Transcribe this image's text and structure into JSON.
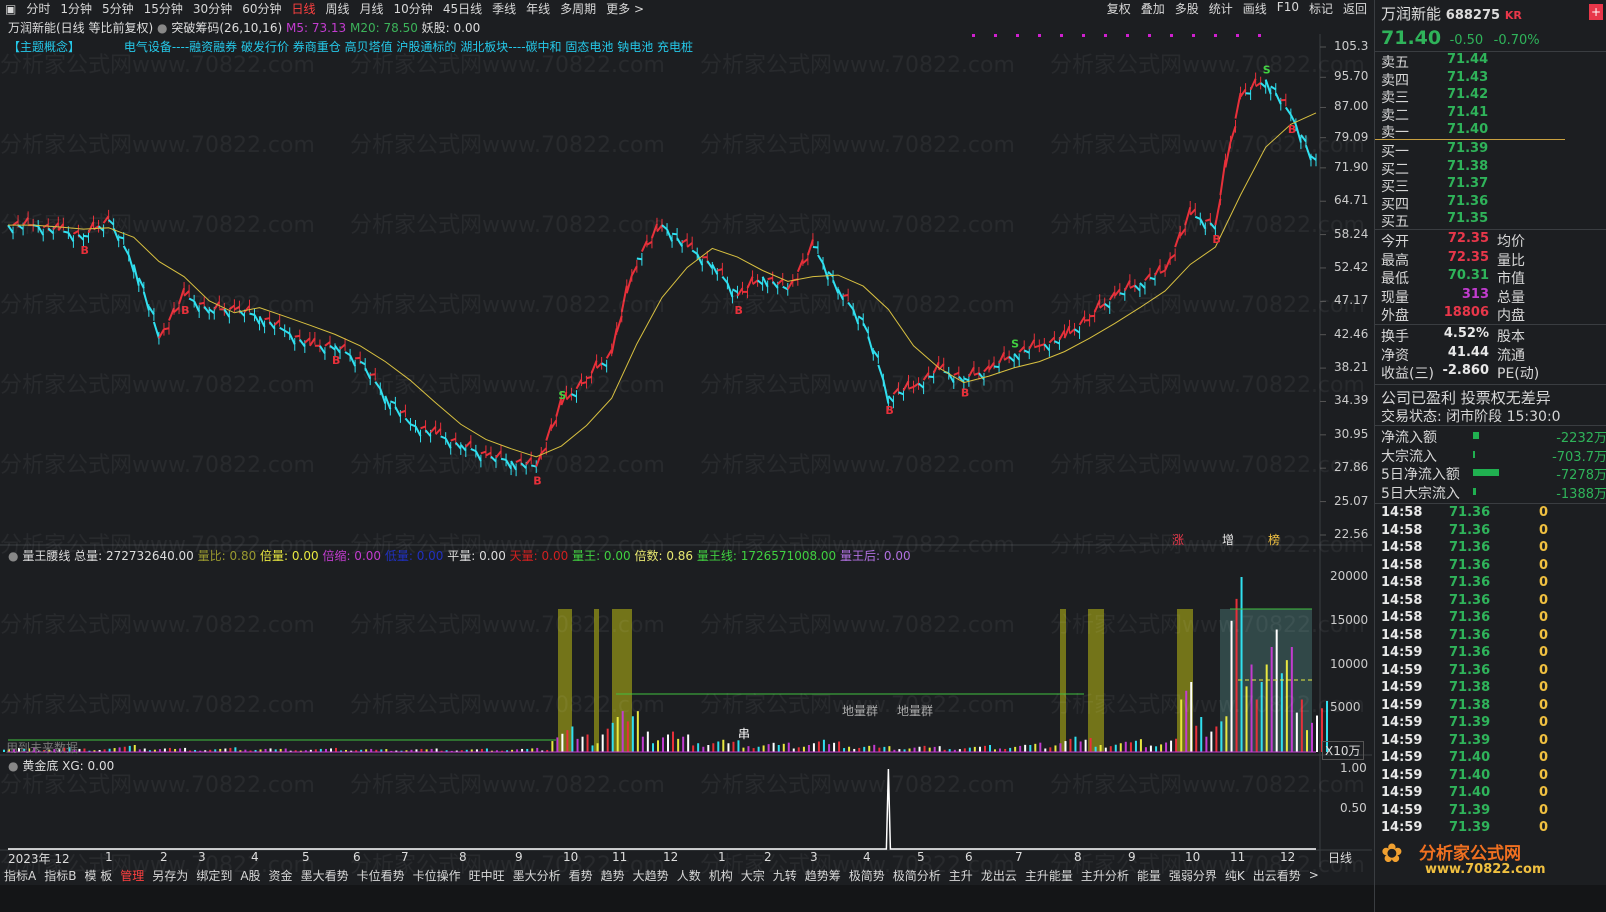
{
  "toolbar": {
    "periods": [
      "分时",
      "1分钟",
      "5分钟",
      "15分钟",
      "30分钟",
      "60分钟",
      "日线",
      "周线",
      "月线",
      "10分钟",
      "45日线",
      "季线",
      "年线",
      "多周期",
      "更多 >"
    ],
    "active_period": "日线",
    "right_tools": [
      "复权",
      "叠加",
      "多股",
      "统计",
      "画线",
      "F10",
      "标记",
      "返回"
    ]
  },
  "chart_header": {
    "title": "万润新能(日线 等比前复权)",
    "indicator": "突破筹码(26,10,16)",
    "m5": "M5: 73.13",
    "m20": "M20: 78.50",
    "yaogu": "妖股: 0.00",
    "concept_label": "【主题概念】",
    "concepts": "电气设备----融资融券 破发行价 券商重仓 高贝塔值 沪股通标的 湖北板块----碳中和 固态电池 钠电池 充电桩"
  },
  "watermark": "分析家公式网www.70822.com",
  "price_axis": [
    "105.3",
    "95.70",
    "87.00",
    "79.09",
    "71.90",
    "64.71",
    "58.24",
    "52.42",
    "47.17",
    "42.46",
    "38.21",
    "34.39",
    "30.95",
    "27.86",
    "25.07",
    "22.56"
  ],
  "price_tags": [
    "涨",
    "增",
    "榜"
  ],
  "volume_header": {
    "name": "量王腰线",
    "total": "总量: 272732640.00",
    "liangbi": "量比: 0.80",
    "beiliang": "倍量: 0.00",
    "beisuo": "倍缩: 0.00",
    "hidden": "低量: 0.00",
    "pingliang": "平量: 0.00",
    "tianliang": "天量: 0.00",
    "liangwang": "量王: 0.00",
    "beishu": "倍数: 0.86",
    "liangwangxian": "量王线: 1726571008.00",
    "liangwanghou": "量王后: 0.00"
  },
  "volume_axis": [
    "20000",
    "15000",
    "10000",
    "5000"
  ],
  "volume_unit": "X10万",
  "volume_labels": {
    "future": "用到未来数据",
    "dilq1": "地量群",
    "dilq2": "地量群",
    "chuan": "串"
  },
  "lower_header": {
    "name": "黄金底",
    "xg": "XG: 0.00"
  },
  "lower_axis": [
    "1.00",
    "0.50"
  ],
  "date_axis": [
    "2023年 12",
    "1",
    "2",
    "3",
    "4",
    "5",
    "6",
    "7",
    "8",
    "9",
    "10",
    "11",
    "12",
    "1",
    "2",
    "3",
    "4",
    "5",
    "6",
    "7",
    "8",
    "9",
    "10",
    "11",
    "12"
  ],
  "bottom_tabs": [
    "指标A",
    "指标B",
    "模 板",
    "管理",
    "另存为",
    "绑定到",
    "A股",
    "资金",
    "墨大看势",
    "卡位看势",
    "卡位操作",
    "旺中旺",
    "墨大分析",
    "看势",
    "趋势",
    "大趋势",
    "人数",
    "机构",
    "大宗",
    "九转",
    "趋势筹",
    "极简势",
    "极简分析",
    "主升",
    "龙出云",
    "主升能量",
    "主升分析",
    "能量",
    "强弱分界",
    "纯K",
    "出云看势",
    ">"
  ],
  "active_bottom_tab": "管理",
  "period_label": "日线",
  "quote": {
    "name": "万润新能",
    "code": "688275",
    "tag": "KR",
    "price": "71.40",
    "change": "-0.50",
    "pct": "-0.70%",
    "asks": [
      {
        "label": "卖五",
        "price": "71.44"
      },
      {
        "label": "卖四",
        "price": "71.43"
      },
      {
        "label": "卖三",
        "price": "71.42"
      },
      {
        "label": "卖二",
        "price": "71.41"
      },
      {
        "label": "卖一",
        "price": "71.40"
      }
    ],
    "bids": [
      {
        "label": "买一",
        "price": "71.39"
      },
      {
        "label": "买二",
        "price": "71.38"
      },
      {
        "label": "买三",
        "price": "71.37"
      },
      {
        "label": "买四",
        "price": "71.36"
      },
      {
        "label": "买五",
        "price": "71.35"
      }
    ],
    "stats": [
      {
        "l": "今开",
        "v": "72.35",
        "c": "r",
        "l2": "均价"
      },
      {
        "l": "最高",
        "v": "72.35",
        "c": "r",
        "l2": "量比"
      },
      {
        "l": "最低",
        "v": "70.31",
        "c": "g",
        "l2": "市值"
      },
      {
        "l": "现量",
        "v": "313",
        "c": "m",
        "l2": "总量"
      },
      {
        "l": "外盘",
        "v": "18806",
        "c": "r",
        "l2": "内盘"
      }
    ],
    "stats2": [
      {
        "l": "换手",
        "v": "4.52%",
        "l2": "股本"
      },
      {
        "l": "净资",
        "v": "41.44",
        "l2": "流通"
      },
      {
        "l": "收益(三)",
        "v": "-2.860",
        "l2": "PE(动)"
      }
    ],
    "notice": "公司已盈利 投票权无差异",
    "trade_status": "交易状态: 闭市阶段 15:30:0",
    "flows": [
      {
        "l": "净流入额",
        "v": "-2232万",
        "bar": 0.08
      },
      {
        "l": "大宗流入",
        "v": "-703.7万",
        "bar": 0.02
      },
      {
        "l": "5日净流入额",
        "v": "-7278万",
        "bar": 0.32
      },
      {
        "l": "5日大宗流入",
        "v": "-1388万",
        "bar": 0.04
      }
    ],
    "ticks": [
      [
        "14:58",
        "71.36",
        "0"
      ],
      [
        "14:58",
        "71.36",
        "0"
      ],
      [
        "14:58",
        "71.36",
        "0"
      ],
      [
        "14:58",
        "71.36",
        "0"
      ],
      [
        "14:58",
        "71.36",
        "0"
      ],
      [
        "14:58",
        "71.36",
        "0"
      ],
      [
        "14:58",
        "71.36",
        "0"
      ],
      [
        "14:58",
        "71.36",
        "0"
      ],
      [
        "14:59",
        "71.36",
        "0"
      ],
      [
        "14:59",
        "71.36",
        "0"
      ],
      [
        "14:59",
        "71.38",
        "0"
      ],
      [
        "14:59",
        "71.38",
        "0"
      ],
      [
        "14:59",
        "71.39",
        "0"
      ],
      [
        "14:59",
        "71.39",
        "0"
      ],
      [
        "14:59",
        "71.40",
        "0"
      ],
      [
        "14:59",
        "71.40",
        "0"
      ],
      [
        "14:59",
        "71.40",
        "0"
      ],
      [
        "14:59",
        "71.39",
        "0"
      ],
      [
        "14:59",
        "71.39",
        "0"
      ]
    ],
    "logo": "分析家公式网",
    "logo_url": "www.70822.com"
  },
  "chart_data": {
    "type": "line",
    "title": "万润新能 日线",
    "ylim": [
      22.56,
      105.3
    ],
    "close": [
      60,
      60,
      59,
      58,
      61,
      53,
      42,
      48,
      46,
      46,
      45,
      43,
      41,
      41,
      39,
      35,
      32,
      31,
      30,
      29,
      28.5,
      28,
      34,
      37,
      40,
      54,
      60,
      56,
      53,
      48,
      51,
      49,
      56,
      49,
      44,
      35,
      36,
      38,
      37,
      38,
      40,
      41,
      42,
      45,
      48,
      50,
      52,
      62,
      60,
      90,
      95,
      85,
      72
    ],
    "volume": [
      400,
      350,
      500,
      300,
      450,
      600,
      400,
      350,
      300,
      400,
      350,
      300,
      300,
      350,
      300,
      250,
      300,
      300,
      250,
      300,
      300,
      350,
      2500,
      1500,
      4000,
      3500,
      2000,
      1500,
      1200,
      1000,
      900,
      800,
      1200,
      900,
      700,
      500,
      600,
      500,
      500,
      600,
      700,
      800,
      1500,
      1200,
      1000,
      1100,
      1300,
      6000,
      3500,
      15000,
      12000,
      9000,
      5000
    ],
    "xg_signal_index": 35,
    "xg": [
      0,
      1
    ]
  }
}
